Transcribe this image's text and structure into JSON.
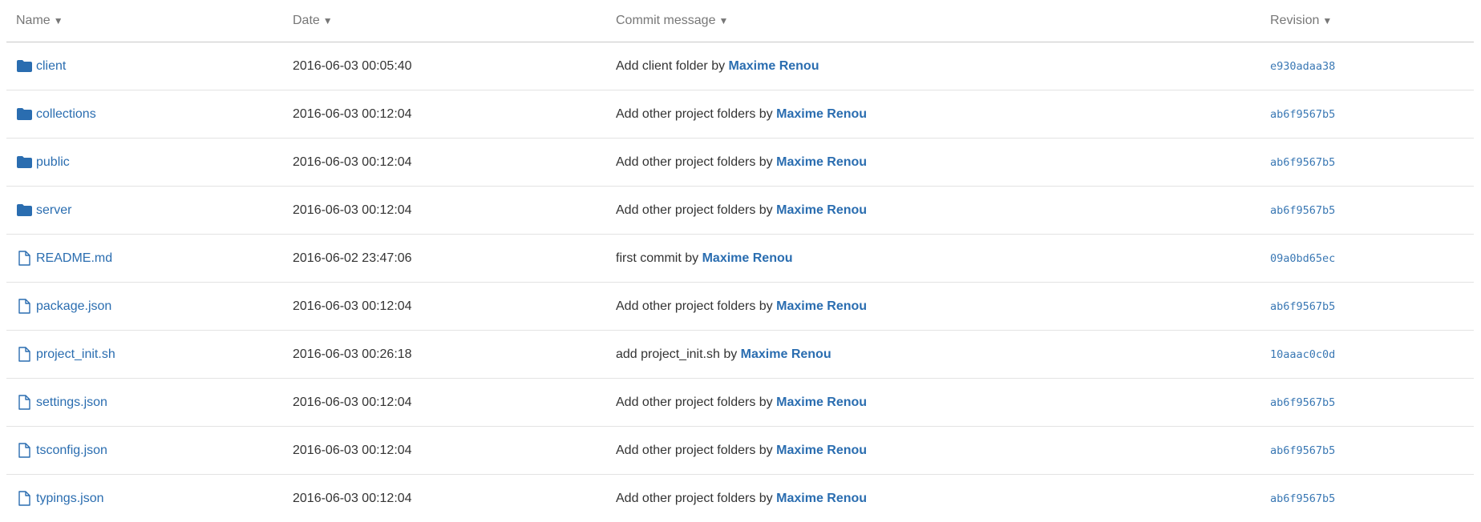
{
  "columns": {
    "name": "Name",
    "date": "Date",
    "message": "Commit message",
    "revision": "Revision",
    "sort_glyph": "▼"
  },
  "colors": {
    "link": "#2a6db0",
    "text": "#333333",
    "header_text": "#777777",
    "folder_icon": "#2a6db0"
  },
  "rows": [
    {
      "type": "folder",
      "icon": "folder-icon",
      "name": "client",
      "date": "2016-06-03 00:05:40",
      "message": "Add client folder",
      "by": "by",
      "author": "Maxime Renou",
      "revision": "e930adaa38"
    },
    {
      "type": "folder",
      "icon": "folder-icon",
      "name": "collections",
      "date": "2016-06-03 00:12:04",
      "message": "Add other project folders",
      "by": "by",
      "author": "Maxime Renou",
      "revision": "ab6f9567b5"
    },
    {
      "type": "folder",
      "icon": "folder-icon",
      "name": "public",
      "date": "2016-06-03 00:12:04",
      "message": "Add other project folders",
      "by": "by",
      "author": "Maxime Renou",
      "revision": "ab6f9567b5"
    },
    {
      "type": "folder",
      "icon": "folder-icon",
      "name": "server",
      "date": "2016-06-03 00:12:04",
      "message": "Add other project folders",
      "by": "by",
      "author": "Maxime Renou",
      "revision": "ab6f9567b5"
    },
    {
      "type": "file",
      "icon": "file-icon",
      "name": "README.md",
      "date": "2016-06-02 23:47:06",
      "message": "first commit",
      "by": "by",
      "author": "Maxime Renou",
      "revision": "09a0bd65ec"
    },
    {
      "type": "file",
      "icon": "file-icon",
      "name": "package.json",
      "date": "2016-06-03 00:12:04",
      "message": "Add other project folders",
      "by": "by",
      "author": "Maxime Renou",
      "revision": "ab6f9567b5"
    },
    {
      "type": "file",
      "icon": "file-icon",
      "name": "project_init.sh",
      "date": "2016-06-03 00:26:18",
      "message": "add project_init.sh",
      "by": "by",
      "author": "Maxime Renou",
      "revision": "10aaac0c0d"
    },
    {
      "type": "file",
      "icon": "file-icon",
      "name": "settings.json",
      "date": "2016-06-03 00:12:04",
      "message": "Add other project folders",
      "by": "by",
      "author": "Maxime Renou",
      "revision": "ab6f9567b5"
    },
    {
      "type": "file",
      "icon": "file-icon",
      "name": "tsconfig.json",
      "date": "2016-06-03 00:12:04",
      "message": "Add other project folders",
      "by": "by",
      "author": "Maxime Renou",
      "revision": "ab6f9567b5"
    },
    {
      "type": "file",
      "icon": "file-icon",
      "name": "typings.json",
      "date": "2016-06-03 00:12:04",
      "message": "Add other project folders",
      "by": "by",
      "author": "Maxime Renou",
      "revision": "ab6f9567b5"
    }
  ]
}
